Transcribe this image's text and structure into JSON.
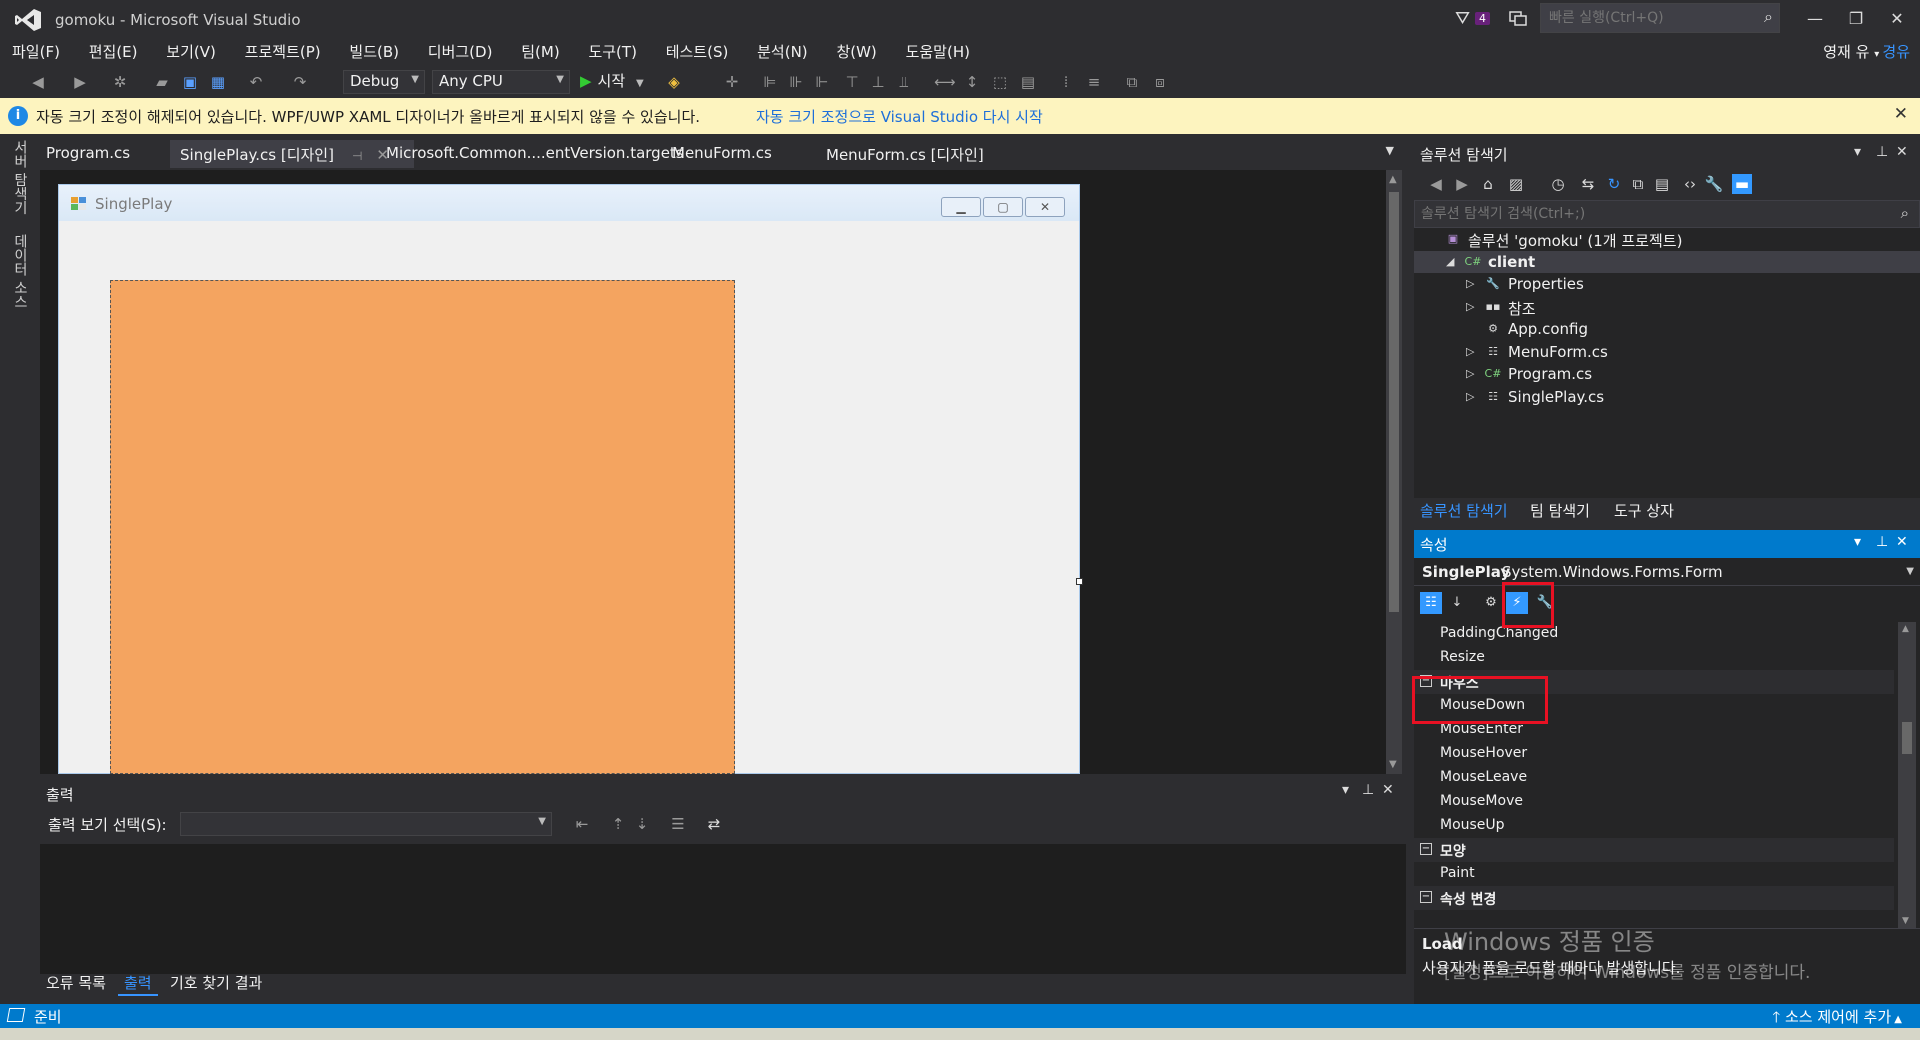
{
  "window": {
    "title": "gomoku - Microsoft Visual Studio",
    "notification_count": "4",
    "quick_launch_placeholder": "빠른 실행(Ctrl+Q)"
  },
  "menu": {
    "items": [
      "파일(F)",
      "편집(E)",
      "보기(V)",
      "프로젝트(P)",
      "빌드(B)",
      "디버그(D)",
      "팀(M)",
      "도구(T)",
      "테스트(S)",
      "분석(N)",
      "창(W)",
      "도움말(H)"
    ],
    "user_name": "영재 유",
    "user_badge": "경유"
  },
  "toolbar": {
    "config": "Debug",
    "platform": "Any CPU",
    "start_label": "시작"
  },
  "infobar": {
    "message": "자동 크기 조정이 해제되어 있습니다. WPF/UWP XAML 디자이너가 올바르게 표시되지 않을 수 있습니다.",
    "link": "자동 크기 조정으로 Visual Studio 다시 시작"
  },
  "left_tabs": [
    "서버 탐색기",
    "데이터 소스"
  ],
  "doc_tabs": [
    {
      "label": "Program.cs",
      "active": false
    },
    {
      "label": "SinglePlay.cs [디자인]",
      "active": true
    },
    {
      "label": "Microsoft.Common....entVersion.targets",
      "active": false
    },
    {
      "label": "MenuForm.cs",
      "active": false
    },
    {
      "label": "MenuForm.cs [디자인]",
      "active": false
    }
  ],
  "designer": {
    "form_title": "SinglePlay",
    "panel_color": "#f4a460"
  },
  "output": {
    "title": "출력",
    "select_label": "출력 보기 선택(S):",
    "bottom_tabs": [
      "오류 목록",
      "출력",
      "기호 찾기 결과"
    ]
  },
  "solution_explorer": {
    "title": "솔루션 탐색기",
    "search_placeholder": "솔루션 탐색기 검색(Ctrl+;)",
    "tree": [
      {
        "label": "솔루션 'gomoku' (1개 프로젝트)",
        "level": 0,
        "icon": "solution-icon",
        "expander": ""
      },
      {
        "label": "client",
        "level": 1,
        "icon": "csharp-project-icon",
        "expander": "◢",
        "selected": true
      },
      {
        "label": "Properties",
        "level": 2,
        "icon": "wrench-icon",
        "expander": "▷"
      },
      {
        "label": "참조",
        "level": 2,
        "icon": "references-icon",
        "expander": "▷"
      },
      {
        "label": "App.config",
        "level": 2,
        "icon": "config-file-icon",
        "expander": ""
      },
      {
        "label": "MenuForm.cs",
        "level": 2,
        "icon": "form-file-icon",
        "expander": "▷"
      },
      {
        "label": "Program.cs",
        "level": 2,
        "icon": "csharp-file-icon",
        "expander": "▷"
      },
      {
        "label": "SinglePlay.cs",
        "level": 2,
        "icon": "form-file-icon",
        "expander": "▷"
      }
    ],
    "bottom_tabs": [
      "솔루션 탐색기",
      "팀 탐색기",
      "도구 상자"
    ]
  },
  "properties": {
    "title": "속성",
    "object_name": "SinglePlay",
    "object_type": "System.Windows.Forms.Form",
    "rows": [
      {
        "label": "PaddingChanged",
        "category": false
      },
      {
        "label": "Resize",
        "category": false
      },
      {
        "label": "마우스",
        "category": true
      },
      {
        "label": "MouseDown",
        "category": false
      },
      {
        "label": "MouseEnter",
        "category": false
      },
      {
        "label": "MouseHover",
        "category": false
      },
      {
        "label": "MouseLeave",
        "category": false
      },
      {
        "label": "MouseMove",
        "category": false
      },
      {
        "label": "MouseUp",
        "category": false
      },
      {
        "label": "모양",
        "category": true
      },
      {
        "label": "Paint",
        "category": false
      },
      {
        "label": "속성 변경",
        "category": true
      }
    ],
    "desc_title": "Load",
    "desc_text": "사용자가 폼을 로드할 때마다 발생합니다."
  },
  "watermark": {
    "line1": "Windows 정품 인증",
    "line2": "[설정]으로 이동하여 Windows를 정품 인증합니다."
  },
  "status": {
    "left": "준비",
    "right": "소스 제어에 추가"
  },
  "colors": {
    "accent": "#007acc",
    "highlight": "#e81123",
    "info_bg": "#fdf4bf"
  }
}
